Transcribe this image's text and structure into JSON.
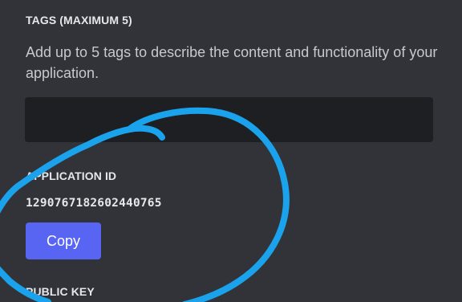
{
  "tags": {
    "title": "TAGS (MAXIMUM 5)",
    "description": "Add up to 5 tags to describe the content and functionality of your application.",
    "input_value": ""
  },
  "application_id": {
    "title": "APPLICATION ID",
    "value": "1290767182602440765",
    "copy_label": "Copy"
  },
  "public_key": {
    "title": "PUBLIC KEY"
  },
  "colors": {
    "background": "#323338",
    "input_background": "#1e1f22",
    "button": "#5865f2",
    "annotation_stroke": "#1aa3ec"
  }
}
